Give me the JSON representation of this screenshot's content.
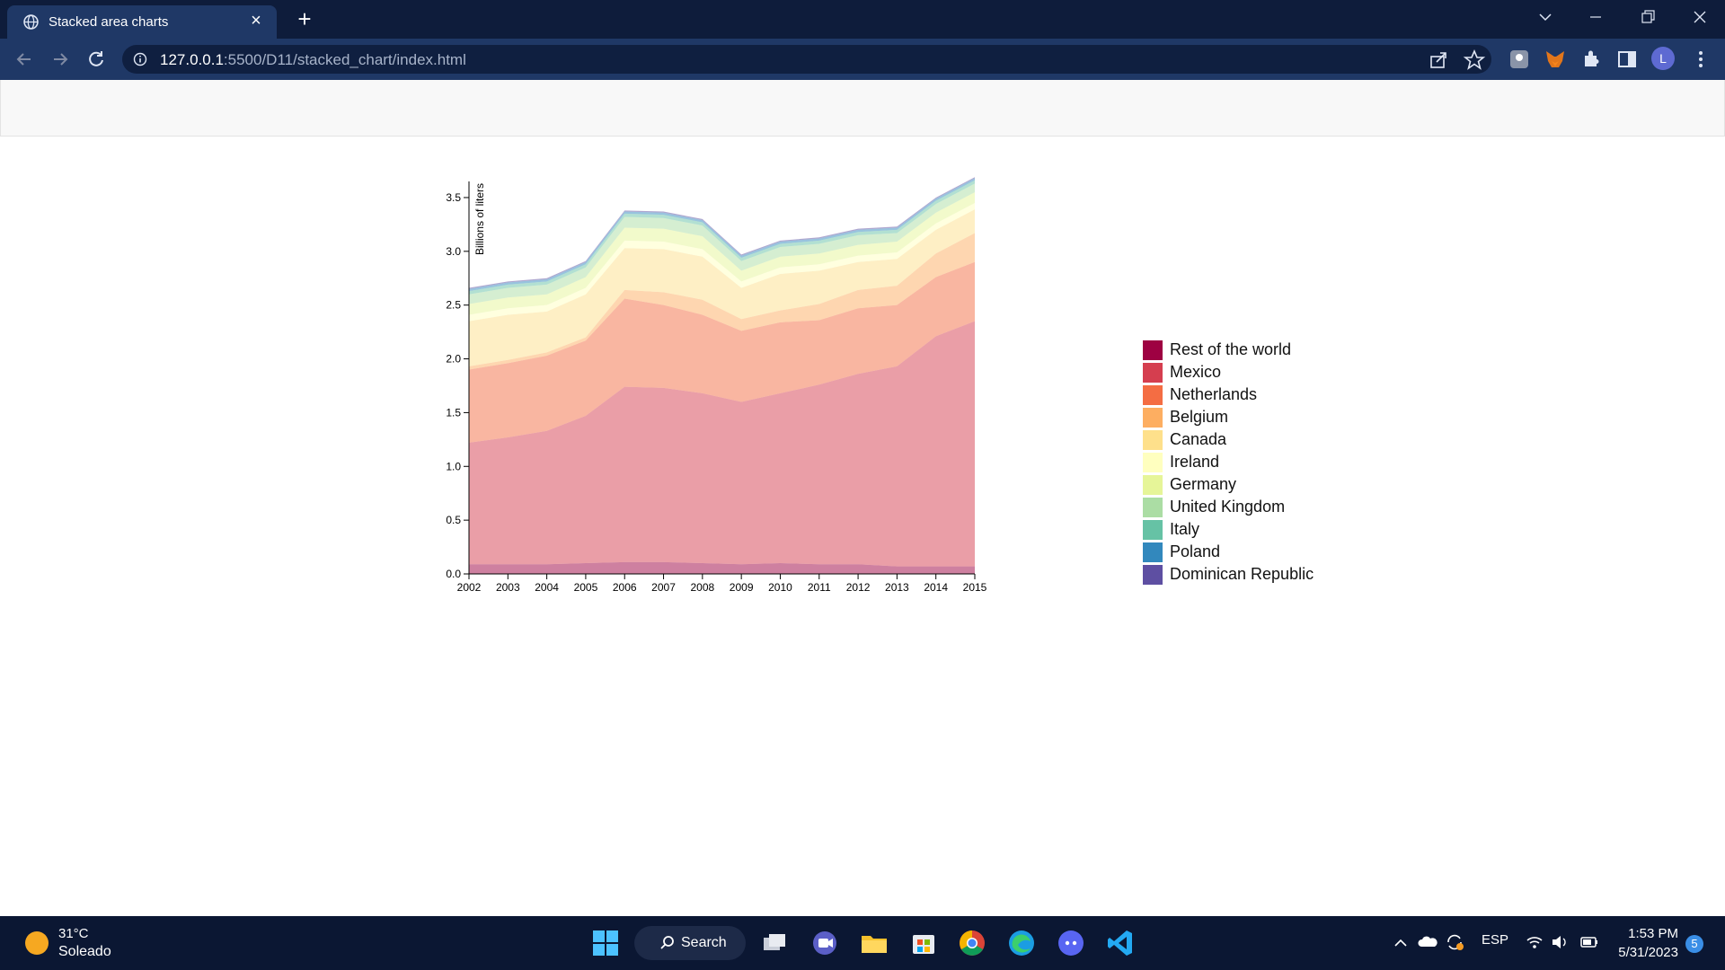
{
  "browser": {
    "tab_title": "Stacked area charts",
    "url_host": "127.0.0.1",
    "url_rest": ":5500/D11/stacked_chart/index.html",
    "profile_initial": "L"
  },
  "chart_data": {
    "type": "area",
    "stacked": true,
    "title": "",
    "xlabel": "",
    "ylabel": "Billions of liters",
    "x": [
      2002,
      2003,
      2004,
      2005,
      2006,
      2007,
      2008,
      2009,
      2010,
      2011,
      2012,
      2013,
      2014,
      2015
    ],
    "ylim": [
      0,
      3.65
    ],
    "yticks": [
      "0.0",
      "0.5",
      "1.0",
      "1.5",
      "2.0",
      "2.5",
      "3.0",
      "3.5"
    ],
    "grid": false,
    "legend_position": "right",
    "series": [
      {
        "name": "Rest of the world",
        "color": "#9e0142",
        "values": [
          0.09,
          0.09,
          0.09,
          0.1,
          0.11,
          0.11,
          0.1,
          0.09,
          0.1,
          0.09,
          0.09,
          0.07,
          0.07,
          0.07
        ]
      },
      {
        "name": "Mexico",
        "color": "#d53e4f",
        "values": [
          1.13,
          1.18,
          1.24,
          1.37,
          1.63,
          1.62,
          1.58,
          1.51,
          1.58,
          1.67,
          1.77,
          1.86,
          2.14,
          2.28
        ]
      },
      {
        "name": "Netherlands",
        "color": "#f46d43",
        "values": [
          0.68,
          0.69,
          0.7,
          0.7,
          0.82,
          0.77,
          0.73,
          0.66,
          0.66,
          0.6,
          0.61,
          0.57,
          0.55,
          0.55
        ]
      },
      {
        "name": "Belgium",
        "color": "#fdae61",
        "values": [
          0.03,
          0.03,
          0.03,
          0.03,
          0.08,
          0.12,
          0.14,
          0.11,
          0.11,
          0.15,
          0.17,
          0.18,
          0.22,
          0.27
        ]
      },
      {
        "name": "Canada",
        "color": "#fee08b",
        "values": [
          0.42,
          0.42,
          0.38,
          0.4,
          0.39,
          0.4,
          0.4,
          0.29,
          0.34,
          0.31,
          0.26,
          0.25,
          0.22,
          0.22
        ]
      },
      {
        "name": "Ireland",
        "color": "#ffffbf",
        "values": [
          0.06,
          0.06,
          0.06,
          0.06,
          0.07,
          0.07,
          0.07,
          0.06,
          0.06,
          0.06,
          0.06,
          0.06,
          0.06,
          0.06
        ]
      },
      {
        "name": "Germany",
        "color": "#e6f598",
        "values": [
          0.1,
          0.1,
          0.1,
          0.1,
          0.12,
          0.12,
          0.12,
          0.1,
          0.1,
          0.1,
          0.1,
          0.1,
          0.1,
          0.1
        ]
      },
      {
        "name": "United Kingdom",
        "color": "#abdda4",
        "values": [
          0.09,
          0.09,
          0.09,
          0.09,
          0.1,
          0.1,
          0.1,
          0.09,
          0.09,
          0.09,
          0.09,
          0.08,
          0.08,
          0.08
        ]
      },
      {
        "name": "Italy",
        "color": "#66c2a5",
        "values": [
          0.03,
          0.03,
          0.03,
          0.03,
          0.03,
          0.03,
          0.03,
          0.03,
          0.03,
          0.03,
          0.03,
          0.03,
          0.03,
          0.03
        ]
      },
      {
        "name": "Poland",
        "color": "#3288bd",
        "values": [
          0.02,
          0.02,
          0.02,
          0.02,
          0.02,
          0.02,
          0.02,
          0.02,
          0.02,
          0.02,
          0.02,
          0.02,
          0.02,
          0.02
        ]
      },
      {
        "name": "Dominican Republic",
        "color": "#5e4fa2",
        "values": [
          0.01,
          0.01,
          0.01,
          0.01,
          0.01,
          0.01,
          0.01,
          0.01,
          0.01,
          0.01,
          0.01,
          0.01,
          0.01,
          0.01
        ]
      }
    ]
  },
  "taskbar": {
    "weather_temp": "31°C",
    "weather_cond": "Soleado",
    "search_label": "Search",
    "lang": "ESP",
    "time": "1:53 PM",
    "date": "5/31/2023",
    "notifications": "5"
  }
}
